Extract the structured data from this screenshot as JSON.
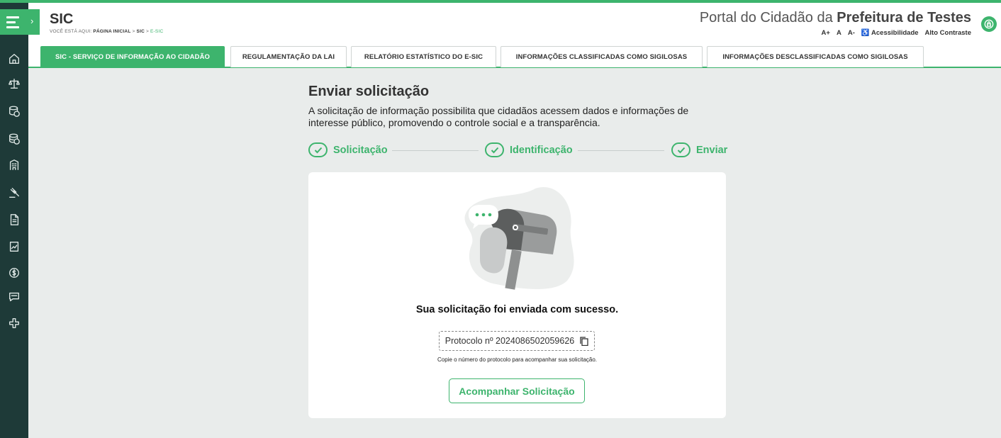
{
  "header": {
    "app_title": "SIC",
    "breadcrumb": {
      "prefix": "VOCÊ ESTÁ AQUI:",
      "items": [
        "PÁGINA INICIAL",
        "SIC",
        "E-SIC"
      ],
      "separator": ">"
    },
    "portal_prefix": "Portal do Cidadão da ",
    "portal_name": "Prefeitura de Testes",
    "accessibility": {
      "increase": "A+",
      "normal": "A",
      "decrease": "A-",
      "accessibility_label": "Acessibilidade",
      "contrast_label": "Alto Contraste"
    }
  },
  "tabs": [
    "SIC - SERVIÇO DE INFORMAÇÃO AO CIDADÃO",
    "REGULAMENTAÇÃO DA LAI",
    "RELATÓRIO ESTATÍSTICO DO E-SIC",
    "INFORMAÇÕES CLASSIFICADAS COMO SIGILOSAS",
    "INFORMAÇÕES DESCLASSIFICADAS COMO SIGILOSAS"
  ],
  "page": {
    "title": "Enviar solicitação",
    "intro": "A solicitação de informação possibilita que cidadãos acessem dados e informações de interesse público, promovendo o controle social e a transparência."
  },
  "steps": [
    "Solicitação",
    "Identificação",
    "Enviar"
  ],
  "card": {
    "success_message": "Sua solicitação foi enviada com sucesso.",
    "protocol_text": "Protocolo nº 2024086502059626",
    "hint": "Copie o número do protocolo para acompanhar sua solicitação.",
    "track_button": "Acompanhar Solicitação"
  },
  "colors": {
    "accent": "#3db46d",
    "sidebar": "#1e3a38",
    "background": "#e9eceb"
  },
  "sidebar_icons": [
    "home-icon",
    "scales-icon",
    "coins-icon",
    "coins-stack-icon",
    "building-icon",
    "gavel-icon",
    "document-icon",
    "report-icon",
    "money-icon",
    "chat-icon",
    "health-cross-icon"
  ]
}
